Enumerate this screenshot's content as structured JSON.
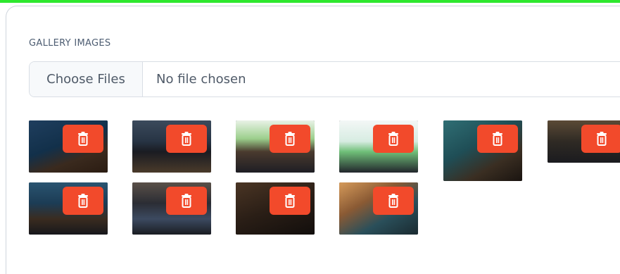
{
  "gallery": {
    "label": "GALLERY IMAGES",
    "file_input": {
      "button_label": "Choose Files",
      "status_text": "No file chosen"
    },
    "delete_icon": "trash-icon",
    "accent_color": "#f24a2b",
    "images": [
      {
        "theme": "stage-blue"
      },
      {
        "theme": "group-photo"
      },
      {
        "theme": "award-green"
      },
      {
        "theme": "award-white"
      },
      {
        "theme": "speaker-teal"
      },
      {
        "theme": "panel-wide"
      },
      {
        "theme": "group-blue"
      },
      {
        "theme": "audience"
      },
      {
        "theme": "speaker-warm"
      },
      {
        "theme": "podium-teal"
      }
    ]
  }
}
